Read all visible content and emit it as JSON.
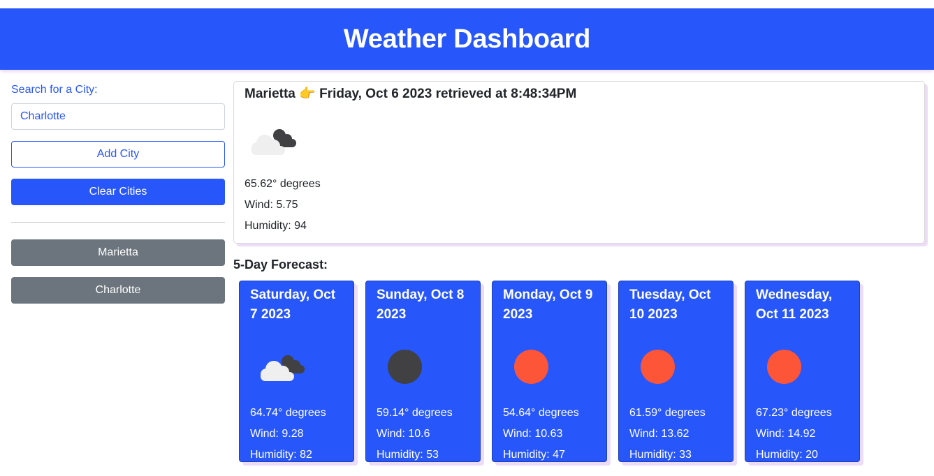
{
  "header": {
    "title": "Weather Dashboard"
  },
  "sidebar": {
    "search_label": "Search for a City:",
    "search_value": "Charlotte",
    "add_label": "Add City",
    "clear_label": "Clear Cities",
    "cities": [
      "Marietta",
      "Charlotte"
    ]
  },
  "current": {
    "title": "Marietta 👉 Friday, Oct 6 2023 retrieved at 8:48:34PM",
    "icon": "cloudy-icon",
    "temp": "65.62° degrees",
    "wind": "Wind: 5.75",
    "humidity": "Humidity: 94"
  },
  "forecast": {
    "heading": "5-Day Forecast:",
    "days": [
      {
        "date": "Saturday, Oct 7 2023",
        "icon": "cloudy-icon",
        "temp": "64.74° degrees",
        "wind": "Wind: 9.28",
        "humidity": "Humidity: 82"
      },
      {
        "date": "Sunday, Oct 8 2023",
        "icon": "dark-circle-icon",
        "icon_color": "#414042",
        "temp": "59.14° degrees",
        "wind": "Wind: 10.6",
        "humidity": "Humidity: 53"
      },
      {
        "date": "Monday, Oct 9 2023",
        "icon": "sun-icon",
        "icon_color": "#fd5537",
        "temp": "54.64° degrees",
        "wind": "Wind: 10.63",
        "humidity": "Humidity: 47"
      },
      {
        "date": "Tuesday, Oct 10 2023",
        "icon": "sun-icon",
        "icon_color": "#fd5537",
        "temp": "61.59° degrees",
        "wind": "Wind: 13.62",
        "humidity": "Humidity: 33"
      },
      {
        "date": "Wednesday, Oct 11 2023",
        "icon": "sun-icon",
        "icon_color": "#fd5537",
        "temp": "67.23° degrees",
        "wind": "Wind: 14.92",
        "humidity": "Humidity: 20"
      }
    ]
  },
  "colors": {
    "primary": "#2756fb",
    "secondary": "#6c757d",
    "shadow": "#ecdcf7"
  }
}
